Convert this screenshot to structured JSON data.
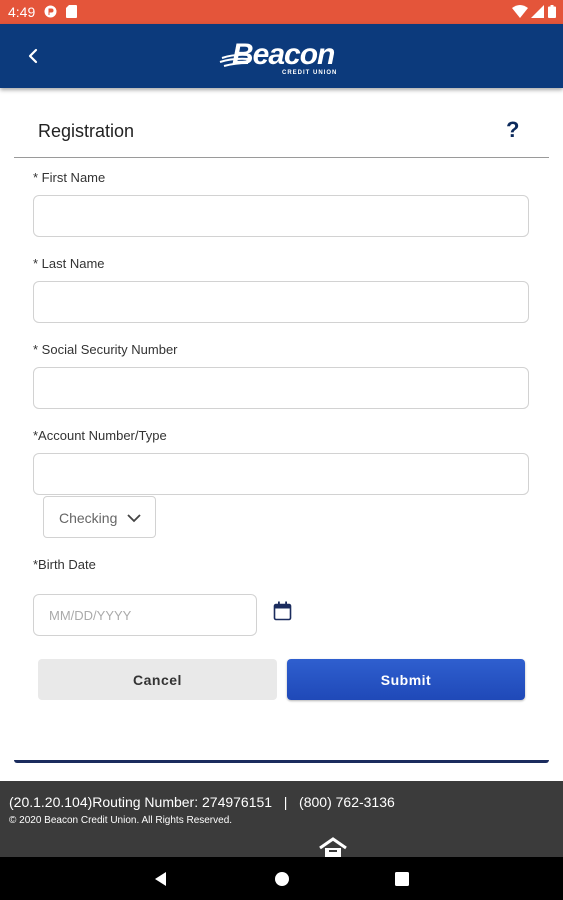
{
  "status_bar": {
    "time": "4:49",
    "icons": [
      "pocket-icon",
      "sd-card-icon",
      "wifi-icon",
      "signal-icon",
      "battery-icon"
    ]
  },
  "app_bar": {
    "logo_text": "Beacon",
    "logo_subtext": "CREDIT UNION",
    "bg_color": "#0c3a7c"
  },
  "form": {
    "title": "Registration",
    "help_label": "?",
    "first_name_label": "* First Name",
    "last_name_label": "* Last Name",
    "ssn_label": "* Social Security Number",
    "account_label": "*Account Number/Type",
    "account_type_selected": "Checking",
    "birth_date_label": "*Birth Date",
    "birth_date_placeholder": "MM/DD/YYYY",
    "cancel_label": "Cancel",
    "submit_label": "Submit"
  },
  "footer": {
    "info": "(20.1.20.104)Routing Number: 274976151   |   (800) 762-3136",
    "copyright": "© 2020 Beacon Credit Union. All Rights Reserved."
  },
  "colors": {
    "status_bar": "#e4553a",
    "brand": "#0c3a7c",
    "submit": "#2350c0",
    "footer": "#3b3b3b"
  }
}
